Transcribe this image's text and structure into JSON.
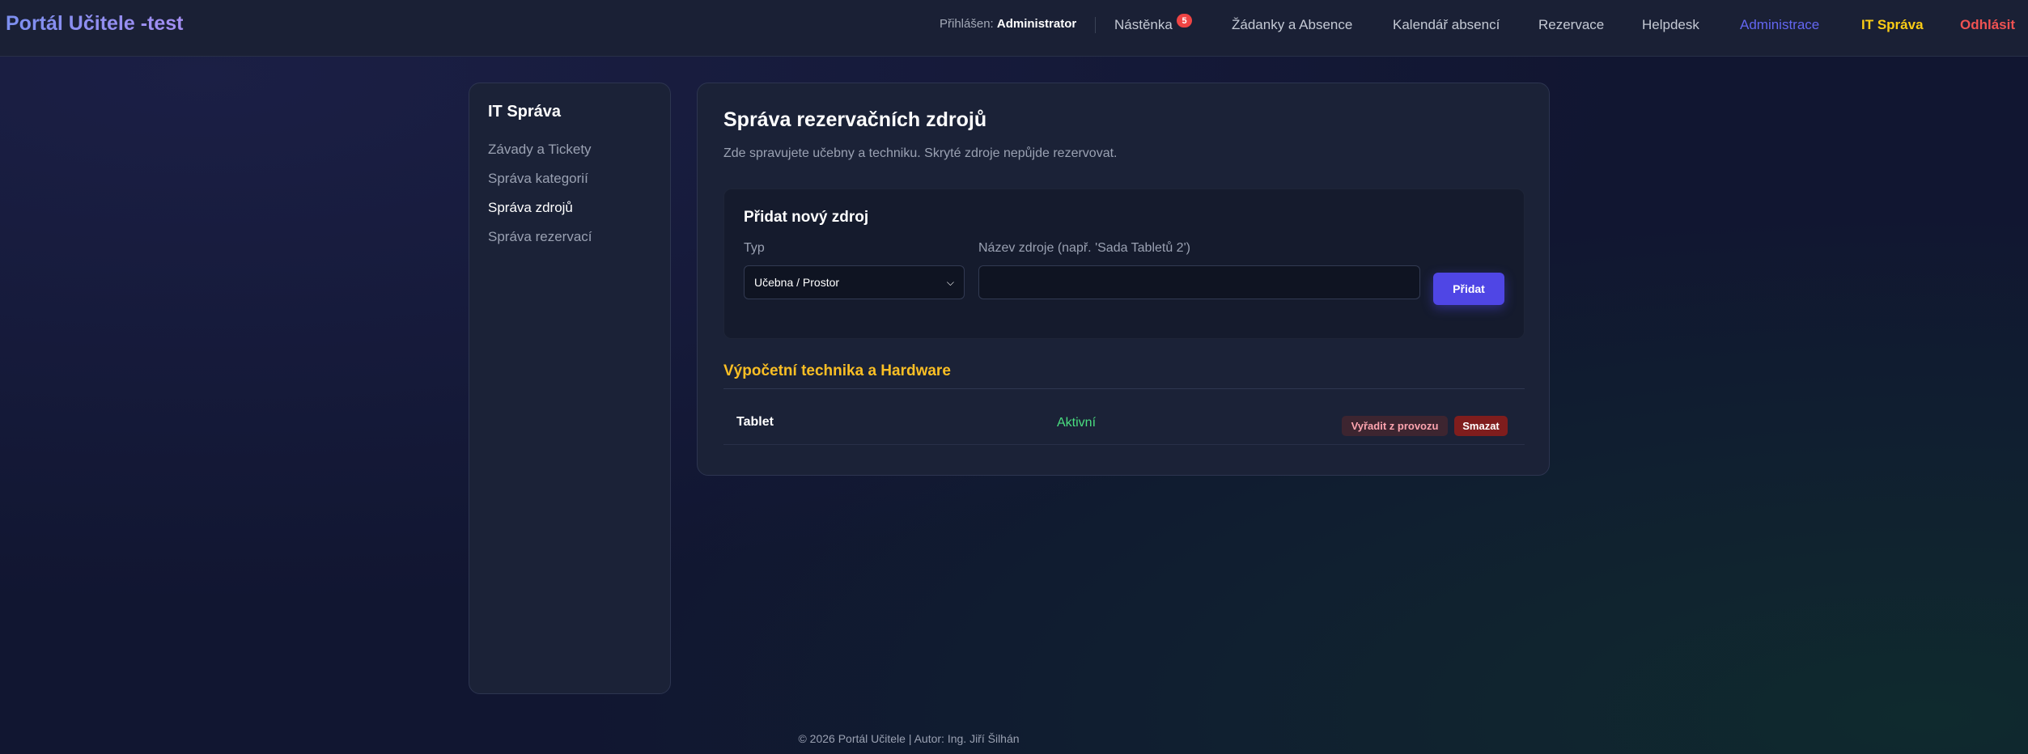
{
  "header": {
    "brand": "Portál Učitele -test",
    "user_prefix": "Přihlášen:",
    "user_name": "Administrator",
    "nav": {
      "dashboard": "Nástěnka",
      "dashboard_badge": "5",
      "requests": "Žádanky a Absence",
      "calendar": "Kalendář absencí",
      "reservations": "Rezervace",
      "helpdesk": "Helpdesk",
      "admin": "Administrace",
      "it": "IT Správa",
      "logout": "Odhlásit"
    }
  },
  "sidebar": {
    "title": "IT Správa",
    "items": [
      {
        "label": "Závady a Tickety",
        "active": false
      },
      {
        "label": "Správa kategorií",
        "active": false
      },
      {
        "label": "Správa zdrojů",
        "active": true
      },
      {
        "label": "Správa rezervací",
        "active": false
      }
    ]
  },
  "main": {
    "title": "Správa rezervačních zdrojů",
    "subtitle": "Zde spravujete učebny a techniku. Skryté zdroje nepůjde rezervovat.",
    "add_form": {
      "title": "Přidat nový zdroj",
      "type_label": "Typ",
      "type_value": "Učebna / Prostor",
      "name_label": "Název zdroje (např. 'Sada Tabletů 2')",
      "name_value": "",
      "submit": "Přidat"
    },
    "section": {
      "title": "Výpočetní technika a Hardware",
      "rows": [
        {
          "name": "Tablet",
          "status": "Aktivní",
          "retire_label": "Vyřadit z provozu",
          "delete_label": "Smazat"
        }
      ]
    }
  },
  "footer": {
    "text": "© 2026 Portál Učitele | Autor: Ing. Jiří Šilhán"
  },
  "colors": {
    "accent": "#4f46e5",
    "it_highlight": "#facc15",
    "logout": "#f05252",
    "active_status": "#4ade80",
    "section_title": "#fbbf24"
  }
}
